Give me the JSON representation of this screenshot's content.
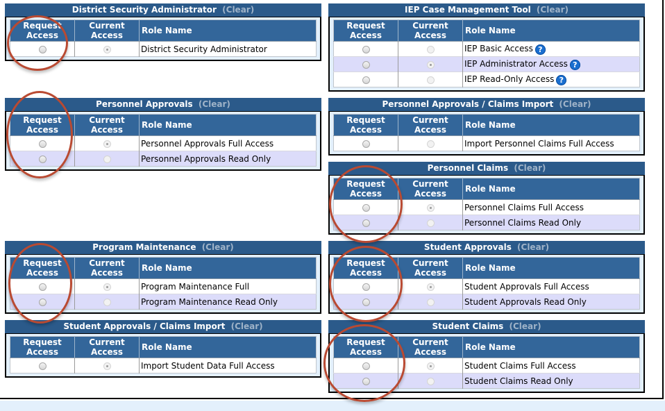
{
  "columns": {
    "request_access": "Request Access",
    "current_access": "Current Access",
    "role_name": "Role Name"
  },
  "clear_label": "(Clear)",
  "colors": {
    "panel_title_bg": "#2b5a8a",
    "header_bg": "#33669a",
    "alt_row_bg": "#dcdcfa",
    "panel_body_bg": "#e3f0fc",
    "annotation_circle": "#b94a32",
    "help_icon": "#1a6fd0"
  },
  "panels": [
    {
      "title": "District Security Administrator",
      "rows": [
        {
          "role": "District Security Administrator",
          "request": false,
          "current": true,
          "help": false
        }
      ]
    },
    {
      "title": "IEP Case Management Tool",
      "rows": [
        {
          "role": "IEP Basic Access",
          "request": false,
          "current": false,
          "help": true
        },
        {
          "role": "IEP Administrator Access",
          "request": false,
          "current": true,
          "help": true
        },
        {
          "role": "IEP Read-Only Access",
          "request": false,
          "current": false,
          "help": true
        }
      ]
    },
    {
      "title": "Personnel Approvals",
      "rows": [
        {
          "role": "Personnel Approvals Full Access",
          "request": false,
          "current": true,
          "help": false
        },
        {
          "role": "Personnel Approvals Read Only",
          "request": false,
          "current": false,
          "help": false
        }
      ]
    },
    {
      "title": "Personnel Approvals / Claims Import",
      "rows": [
        {
          "role": "Import Personnel Claims Full Access",
          "request": false,
          "current": false,
          "help": false
        }
      ]
    },
    {
      "title": "Personnel Claims",
      "rows": [
        {
          "role": "Personnel Claims Full Access",
          "request": false,
          "current": true,
          "help": false
        },
        {
          "role": "Personnel Claims Read Only",
          "request": false,
          "current": false,
          "help": false
        }
      ]
    },
    {
      "title": "Program Maintenance",
      "rows": [
        {
          "role": "Program Maintenance Full",
          "request": false,
          "current": true,
          "help": false
        },
        {
          "role": "Program Maintenance Read Only",
          "request": false,
          "current": false,
          "help": false
        }
      ]
    },
    {
      "title": "Student Approvals",
      "rows": [
        {
          "role": "Student Approvals Full Access",
          "request": false,
          "current": true,
          "help": false
        },
        {
          "role": "Student Approvals Read Only",
          "request": false,
          "current": false,
          "help": false
        }
      ]
    },
    {
      "title": "Student Approvals / Claims Import",
      "rows": [
        {
          "role": "Import Student Data Full Access",
          "request": false,
          "current": true,
          "help": false
        }
      ]
    },
    {
      "title": "Student Claims",
      "rows": [
        {
          "role": "Student Claims Full Access",
          "request": false,
          "current": true,
          "help": false
        },
        {
          "role": "Student Claims Read Only",
          "request": false,
          "current": false,
          "help": false
        }
      ]
    }
  ],
  "help_icon_glyph": "?"
}
